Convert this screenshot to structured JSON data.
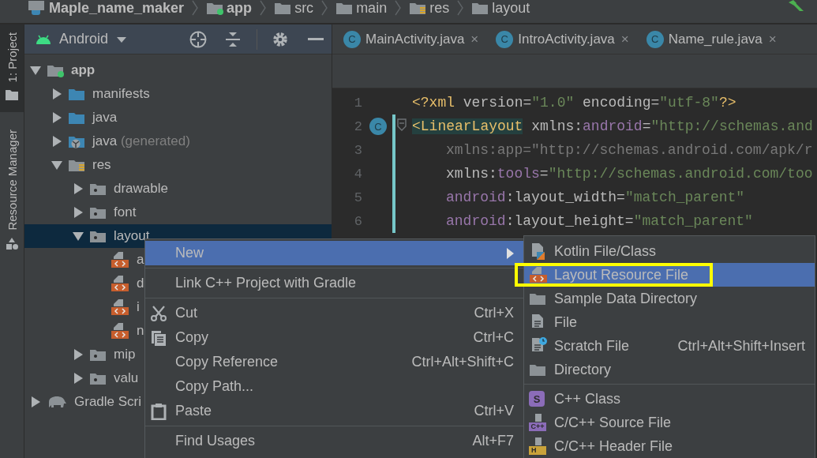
{
  "breadcrumbs": [
    {
      "label": "Maple_name_maker",
      "kind": "project"
    },
    {
      "label": "app",
      "kind": "module"
    },
    {
      "label": "src",
      "kind": "plain"
    },
    {
      "label": "main",
      "kind": "plain"
    },
    {
      "label": "res",
      "kind": "res"
    },
    {
      "label": "layout",
      "kind": "plain"
    }
  ],
  "tool_strip": [
    {
      "label": "1: Project",
      "kind": "project",
      "selected": true
    },
    {
      "label": "Resource Manager",
      "kind": "shapes",
      "selected": false
    }
  ],
  "project": {
    "view": "Android",
    "tree": [
      {
        "label": "app",
        "kind": "module",
        "expanded": true,
        "selected": false,
        "children": [
          {
            "label": "manifests",
            "kind": "folder",
            "expanded": false,
            "selected": false
          },
          {
            "label": "java",
            "kind": "folder",
            "expanded": false,
            "selected": false
          },
          {
            "label": "java",
            "note": "(generated)",
            "kind": "generated",
            "expanded": false,
            "selected": false
          },
          {
            "label": "res",
            "kind": "res",
            "expanded": true,
            "selected": false,
            "children": [
              {
                "label": "drawable",
                "kind": "resdir",
                "expanded": false,
                "selected": false
              },
              {
                "label": "font",
                "kind": "resdir",
                "expanded": false,
                "selected": false
              },
              {
                "label": "layout",
                "kind": "resdir",
                "expanded": true,
                "selected": true,
                "children": [
                  {
                    "label": "a",
                    "kind": "layout",
                    "selected": false
                  },
                  {
                    "label": "d",
                    "kind": "layout",
                    "selected": false
                  },
                  {
                    "label": "i",
                    "kind": "layout",
                    "selected": false
                  },
                  {
                    "label": "n",
                    "kind": "layout",
                    "selected": false
                  }
                ]
              },
              {
                "label": "mip",
                "kind": "resdir",
                "expanded": false,
                "selected": false
              },
              {
                "label": "valu",
                "kind": "resdir",
                "expanded": false,
                "selected": false
              }
            ]
          }
        ]
      },
      {
        "label": "Gradle Scri",
        "kind": "gradle",
        "expanded": false,
        "selected": false
      }
    ]
  },
  "editor": {
    "tabs": [
      {
        "badge": "C",
        "label": "MainActivity.java",
        "close": "×",
        "selected": false
      },
      {
        "badge": "C",
        "label": "IntroActivity.java",
        "close": "×",
        "selected": false
      },
      {
        "badge": "C",
        "label": "Name_rule.java",
        "close": "×",
        "selected": false
      }
    ],
    "lines": [
      {
        "number": "1",
        "changed": false,
        "indented": false,
        "tokens": [
          {
            "text": "<?xml",
            "kind": "tag"
          },
          {
            "text": " version",
            "kind": "attr"
          },
          {
            "text": "=",
            "kind": "attr"
          },
          {
            "text": "\"1.0\"",
            "kind": "value"
          },
          {
            "text": " encoding",
            "kind": "attr"
          },
          {
            "text": "=",
            "kind": "attr"
          },
          {
            "text": "\"utf-8\"",
            "kind": "value"
          },
          {
            "text": "?>",
            "kind": "tag"
          }
        ]
      },
      {
        "number": "2",
        "gutter_badge": "C",
        "fold": true,
        "changed": true,
        "indented": false,
        "tokens": [
          {
            "text": "<LinearLayout",
            "kind": "tag",
            "highlighted": true
          },
          {
            "text": " xmlns:",
            "kind": "attr"
          },
          {
            "text": "android",
            "kind": "ns"
          },
          {
            "text": "=",
            "kind": "attr"
          },
          {
            "text": "\"http://schemas.and",
            "kind": "value"
          }
        ]
      },
      {
        "number": "3",
        "changed": true,
        "indented": true,
        "tokens": [
          {
            "text": "xmlns:app=\"http://schemas.android.com/apk/r",
            "kind": "unused"
          }
        ]
      },
      {
        "number": "4",
        "changed": true,
        "indented": true,
        "tokens": [
          {
            "text": "xmlns:",
            "kind": "attr"
          },
          {
            "text": "tools",
            "kind": "ns"
          },
          {
            "text": "=",
            "kind": "attr"
          },
          {
            "text": "\"http://schemas.android.com/too",
            "kind": "value"
          }
        ]
      },
      {
        "number": "5",
        "changed": true,
        "indented": true,
        "tokens": [
          {
            "text": "android",
            "kind": "ns"
          },
          {
            "text": ":layout_width",
            "kind": "attr"
          },
          {
            "text": "=",
            "kind": "attr"
          },
          {
            "text": "\"match_parent\"",
            "kind": "value"
          }
        ]
      },
      {
        "number": "6",
        "changed": true,
        "indented": true,
        "tokens": [
          {
            "text": "android",
            "kind": "ns"
          },
          {
            "text": ":layout_height",
            "kind": "attr"
          },
          {
            "text": "=",
            "kind": "attr"
          },
          {
            "text": "\"match_parent\"",
            "kind": "value"
          }
        ]
      }
    ]
  },
  "context_menu": {
    "items": [
      {
        "kind": "submenu",
        "label": "New",
        "selected": true
      },
      {
        "kind": "separator"
      },
      {
        "kind": "text",
        "label": "Link C++ Project with Gradle",
        "selected": false
      },
      {
        "kind": "separator"
      },
      {
        "kind": "cut",
        "label": "Cut",
        "shortcut": "Ctrl+X",
        "selected": false
      },
      {
        "kind": "copy",
        "label": "Copy",
        "shortcut": "Ctrl+C",
        "selected": false
      },
      {
        "kind": "text",
        "label": "Copy Reference",
        "shortcut": "Ctrl+Alt+Shift+C",
        "selected": false
      },
      {
        "kind": "text",
        "label": "Copy Path...",
        "selected": false
      },
      {
        "kind": "paste",
        "label": "Paste",
        "shortcut": "Ctrl+V",
        "selected": false
      },
      {
        "kind": "separator"
      },
      {
        "kind": "text",
        "label": "Find Usages",
        "shortcut": "Alt+F7",
        "selected": false
      }
    ]
  },
  "submenu": {
    "items": [
      {
        "kind": "kotlin",
        "label": "Kotlin File/Class",
        "selected": false
      },
      {
        "kind": "layout",
        "label": "Layout Resource File",
        "selected": true
      },
      {
        "kind": "plain",
        "label": "Sample Data Directory",
        "selected": false
      },
      {
        "kind": "file",
        "label": "File",
        "selected": false
      },
      {
        "kind": "scratch",
        "label": "Scratch File",
        "shortcut": "Ctrl+Alt+Shift+Insert",
        "selected": false
      },
      {
        "kind": "plain",
        "label": "Directory",
        "selected": false
      },
      {
        "kind": "separator"
      },
      {
        "kind": "cppclass",
        "label": "C++ Class",
        "badge": "S",
        "selected": false
      },
      {
        "kind": "cppsource",
        "label": "C/C++ Source File",
        "badge": "C++",
        "selected": false
      },
      {
        "kind": "header",
        "label": "C/C++ Header File",
        "badge": "H",
        "selected": false
      }
    ]
  },
  "highlight_frame": true
}
